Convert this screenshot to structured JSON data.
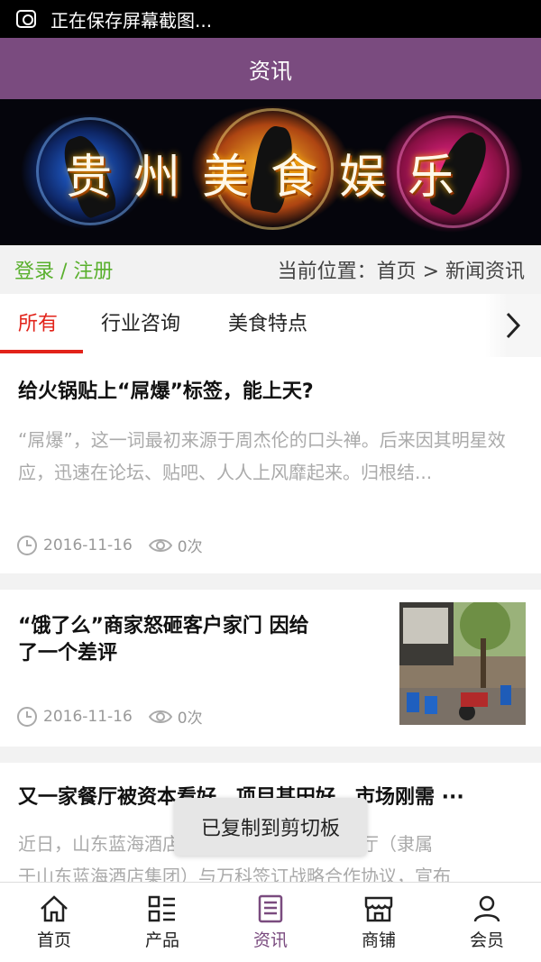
{
  "status_bar": {
    "text": "正在保存屏幕截图..."
  },
  "header": {
    "title": "资讯"
  },
  "banner": {
    "text": "贵州美食娱乐"
  },
  "location": {
    "login_text": "登录 / 注册",
    "breadcrumb": "当前位置：首页 > 新闻资讯"
  },
  "tabs": [
    {
      "label": "所有",
      "active": true
    },
    {
      "label": "行业咨询",
      "active": false
    },
    {
      "label": "美食特点",
      "active": false
    }
  ],
  "articles": [
    {
      "title": "给火锅贴上“屌爆”标签，能上天?",
      "summary": "“屌爆”，这一词最初来源于周杰伦的口头禅。后来因其明星效应，迅速在论坛、贴吧、人人上风靡起来。归根结...",
      "date": "2016-11-16",
      "views": "0次"
    },
    {
      "title_line1": "“饿了么”商家怒砸客户家门 因给",
      "title_line2": "了一个差评",
      "date": "2016-11-16",
      "views": "0次"
    },
    {
      "title": "又一家餐厅被资本看好，项目甚田好、市场刚需 ···",
      "summary_line1": "近日，山东蓝海酒店集团旗下品牌汉智选餐厅（隶属",
      "summary_line2": "于山东蓝海酒店集团）与万科签订战略合作协议，宣布"
    }
  ],
  "toast": {
    "text": "已复制到剪切板"
  },
  "bottom_nav": [
    {
      "label": "首页",
      "icon": "home-icon"
    },
    {
      "label": "产品",
      "icon": "grid-list-icon"
    },
    {
      "label": "资讯",
      "icon": "document-icon",
      "active": true
    },
    {
      "label": "商铺",
      "icon": "store-icon"
    },
    {
      "label": "会员",
      "icon": "user-icon"
    }
  ],
  "colors": {
    "header": "#7a4b7f",
    "accent": "#e2231a",
    "login": "#5ab02e"
  }
}
